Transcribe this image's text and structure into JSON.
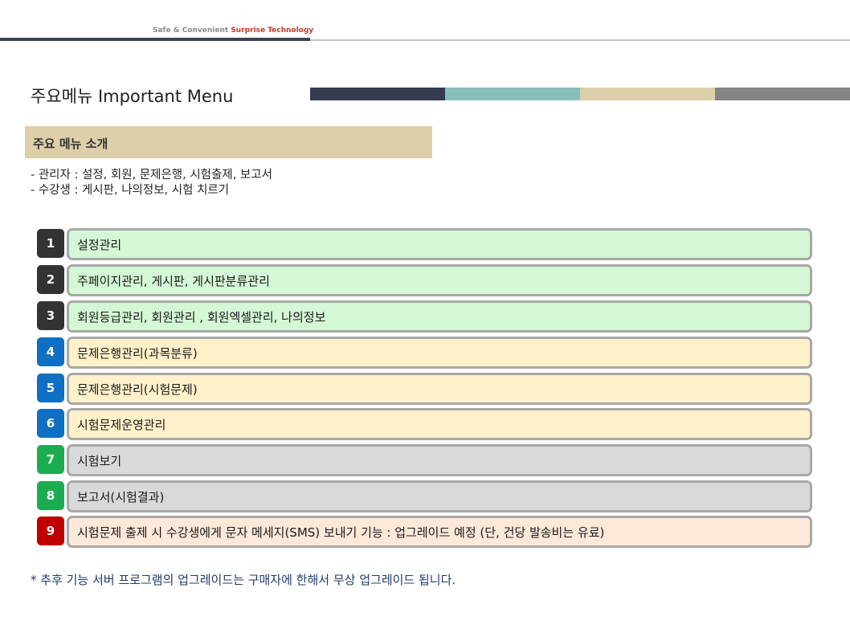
{
  "header": {
    "tagline_prefix": "Safe & Convenient",
    "tagline_brand": "Surprise Technology"
  },
  "title": "주요메뉴 Important Menu",
  "colors": {
    "bar": [
      "#353d51",
      "#88bfbd",
      "#dccfaa",
      "#858585"
    ],
    "dark_badge": "#333333",
    "blue_badge": "#0f6fc2",
    "green_badge": "#1cac50",
    "red_badge": "#c00000",
    "green_box": "#d4f7d6",
    "yellow_box": "#fff1c9",
    "gray_box": "#d9d9d9",
    "peach_box": "#fde8d9"
  },
  "section": {
    "header": "주요 메뉴 소개"
  },
  "intro": [
    "-  관리자 : 설정, 회원, 문제은행, 시험출제, 보고서",
    "-  수강생 : 게시판, 나의정보, 시험 치르기"
  ],
  "menu_items": [
    {
      "number": "1",
      "label": "설정관리"
    },
    {
      "number": "2",
      "label": "주페이지관리, 게시판, 게시판분류관리"
    },
    {
      "number": "3",
      "label": "회원등급관리, 회원관리 , 회원엑셀관리, 나의정보"
    },
    {
      "number": "4",
      "label": "문제은행관리(과목분류)"
    },
    {
      "number": "5",
      "label": "문제은행관리(시험문제)"
    },
    {
      "number": "6",
      "label": "시험문제운영관리"
    },
    {
      "number": "7",
      "label": "시험보기"
    },
    {
      "number": "8",
      "label": "보고서(시험결과)"
    },
    {
      "number": "9",
      "label": "시험문제 출제 시 수강생에게 문자 메세지(SMS) 보내기 기능 : 업그레이드 예정 (단, 건당 발송비는 유료)"
    }
  ],
  "footnote": "* 추후 기능 서버 프로그램의 업그레이드는 구매자에 한해서 무상 업그레이드 됩니다."
}
